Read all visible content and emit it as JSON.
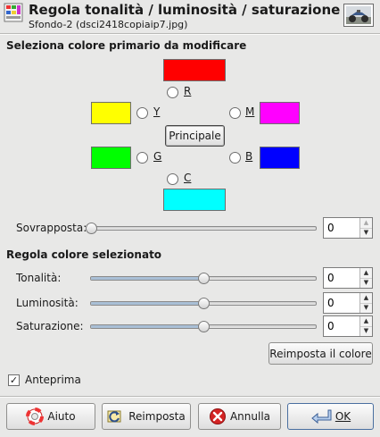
{
  "header": {
    "title": "Regola tonalità / luminosità / saturazione",
    "subtitle": "Sfondo-2 (dsci2418copiaip7.jpg)"
  },
  "primary": {
    "section_title": "Seleziona colore primario da modificare",
    "colors": {
      "red": "#ff0000",
      "yellow": "#ffff00",
      "magenta": "#ff00ff",
      "green": "#00ff00",
      "blue": "#0000ff",
      "cyan": "#00ffff"
    },
    "labels": {
      "r": "R",
      "y": "Y",
      "m": "M",
      "g": "G",
      "b": "B",
      "c": "C"
    },
    "master_button": "Principale",
    "overlap_label": "Sovrapposta:",
    "overlap_value": "0",
    "overlap_fraction": 0.0
  },
  "adjust": {
    "section_title": "Regola colore selezionato",
    "hue_label": "Tonalità:",
    "hue_value": "0",
    "hue_fraction": 0.5,
    "lightness_label": "Luminosità:",
    "lightness_value": "0",
    "lightness_fraction": 0.5,
    "saturation_label": "Saturazione:",
    "saturation_value": "0",
    "saturation_fraction": 0.5,
    "reset_color_button": "Reimposta il colore"
  },
  "preview": {
    "label": "Anteprima",
    "checked": true
  },
  "footer": {
    "help_button": "Aiuto",
    "reset_button": "Reimposta",
    "cancel_button": "Annulla",
    "ok_button": "OK"
  }
}
